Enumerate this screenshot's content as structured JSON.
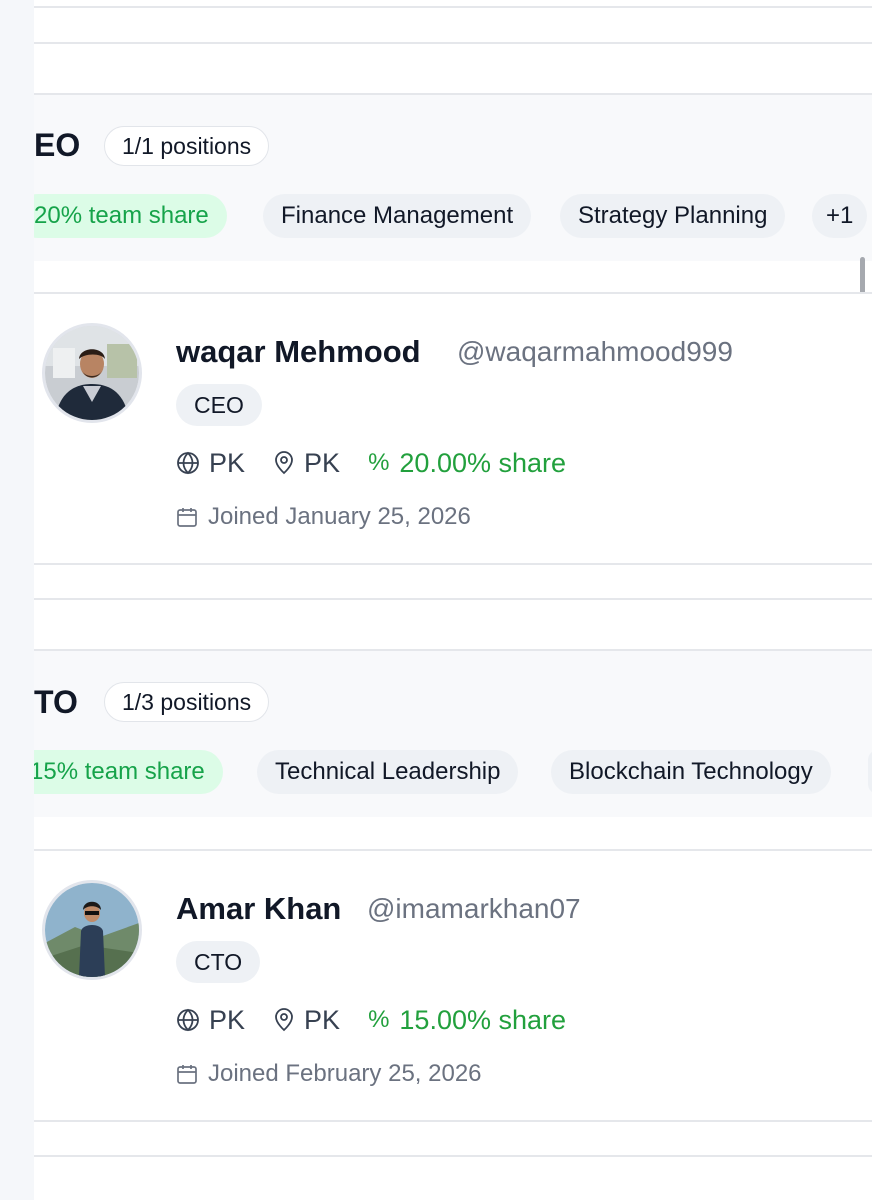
{
  "sections": [
    {
      "role_title": "EO",
      "positions": "1/1 positions",
      "share_chip": "20% team share",
      "skills": [
        "Finance Management",
        "Strategy Planning"
      ],
      "more_skills": "+1",
      "member": {
        "name": "waqar Mehmood",
        "handle": "@waqarmahmood999",
        "role": "CEO",
        "country": "PK",
        "location": "PK",
        "share": "20.00% share",
        "joined": "Joined January 25, 2026"
      }
    },
    {
      "role_title": "TO",
      "positions": "1/3 positions",
      "share_chip": "15% team share",
      "skills": [
        "Technical Leadership",
        "Blockchain Technology"
      ],
      "member": {
        "name": "Amar Khan",
        "handle": "@imamarkhan07",
        "role": "CTO",
        "country": "PK",
        "location": "PK",
        "share": "15.00% share",
        "joined": "Joined February 25, 2026"
      }
    }
  ],
  "colors": {
    "share_green": "#22a03d",
    "share_chip_bg": "#dcfce7",
    "chip_bg": "#eef1f5",
    "muted_text": "#6b7280"
  },
  "icons": [
    "globe-icon",
    "map-pin-icon",
    "percent-icon",
    "calendar-icon"
  ]
}
